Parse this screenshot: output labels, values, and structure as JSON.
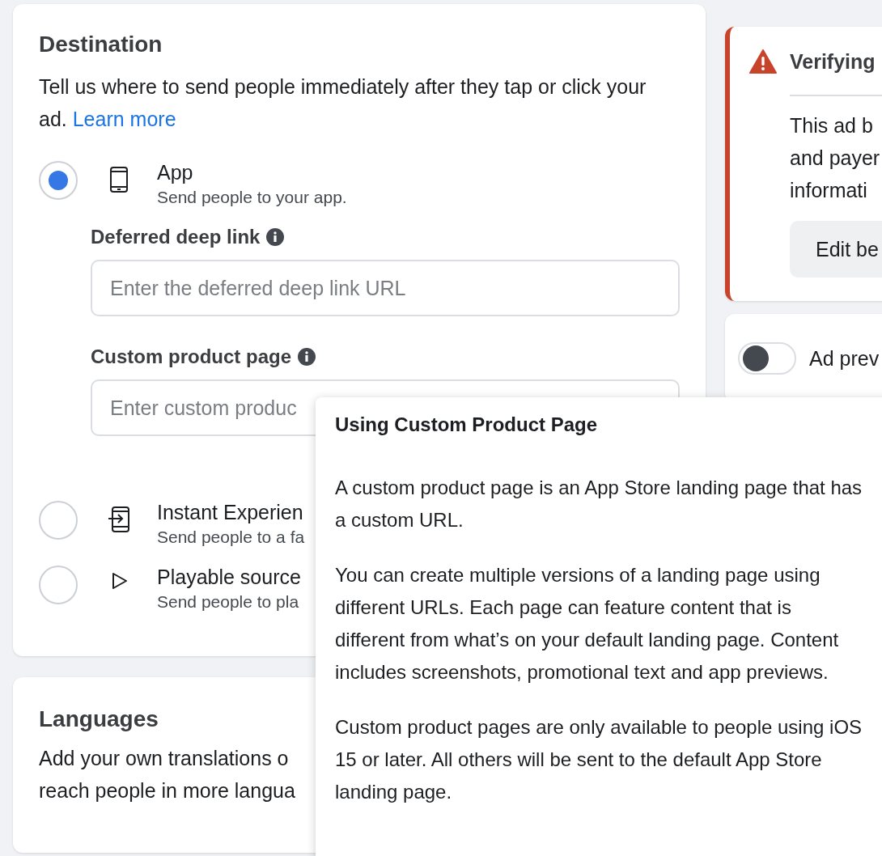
{
  "destination": {
    "title": "Destination",
    "description": "Tell us where to send people immediately after they tap or click your ad.",
    "learn_more": "Learn more",
    "options": [
      {
        "kind": "app",
        "title": "App",
        "subtitle": "Send people to your app.",
        "selected": true,
        "fields": [
          {
            "label": "Deferred deep link",
            "placeholder": "Enter the deferred deep link URL"
          },
          {
            "label": "Custom product page",
            "placeholder": "Enter custom produc"
          }
        ]
      },
      {
        "kind": "instant",
        "title": "Instant Experien",
        "subtitle": "Send people to a fa",
        "selected": false
      },
      {
        "kind": "playable",
        "title": "Playable source",
        "subtitle": "Send people to pla",
        "selected": false
      }
    ]
  },
  "languages": {
    "title": "Languages",
    "lines": [
      "Add your own translations o",
      "reach people in more langua"
    ]
  },
  "alert": {
    "title": "Verifying",
    "lines": [
      "This ad b",
      "and payer",
      "informati"
    ],
    "button": "Edit be"
  },
  "preview": {
    "label": "Ad prev",
    "on": false
  },
  "tooltip": {
    "title": "Using Custom Product Page",
    "paragraphs": [
      "A custom product page is an App Store landing page that has a custom URL.",
      "You can create multiple versions of a landing page using different URLs. Each page can feature content that is different from what’s on your default landing page. Content includes screenshots, promotional text and app previews.",
      "Custom product pages are only available to people using iOS 15 or later. All others will be sent to the default App Store landing page."
    ]
  }
}
